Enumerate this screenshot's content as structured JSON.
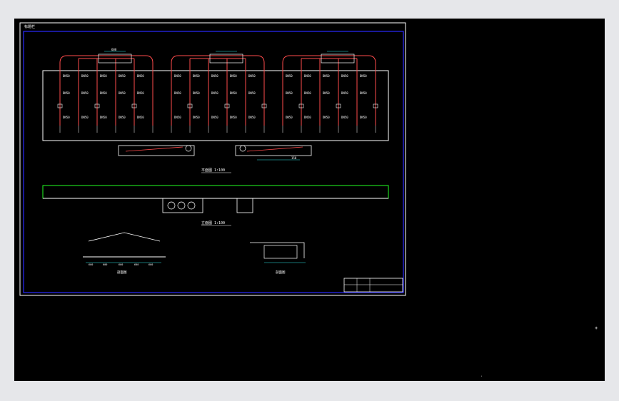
{
  "sheet": {
    "title_block_label": "标题栏",
    "plan_label": "平面图 1:100",
    "elevation_label": "立面图 1:100",
    "section_a_label": "剖面图",
    "section_b_label": "剖面图",
    "dim_top": "600",
    "dim_bottom": "150",
    "cell_label": "DN50",
    "section_dims": [
      "600",
      "600",
      "600",
      "600",
      "600"
    ]
  },
  "colors": {
    "workspace": "#000000",
    "frame": "#ffffff",
    "inner_frame": "#2a2aff",
    "pipe": "#ff4b4b",
    "wall": "#ffffff",
    "green": "#22ff22",
    "cyan": "#2ee6e6",
    "yellow": "#ffff44"
  },
  "icons": {
    "cursor": "crosshair-icon"
  }
}
